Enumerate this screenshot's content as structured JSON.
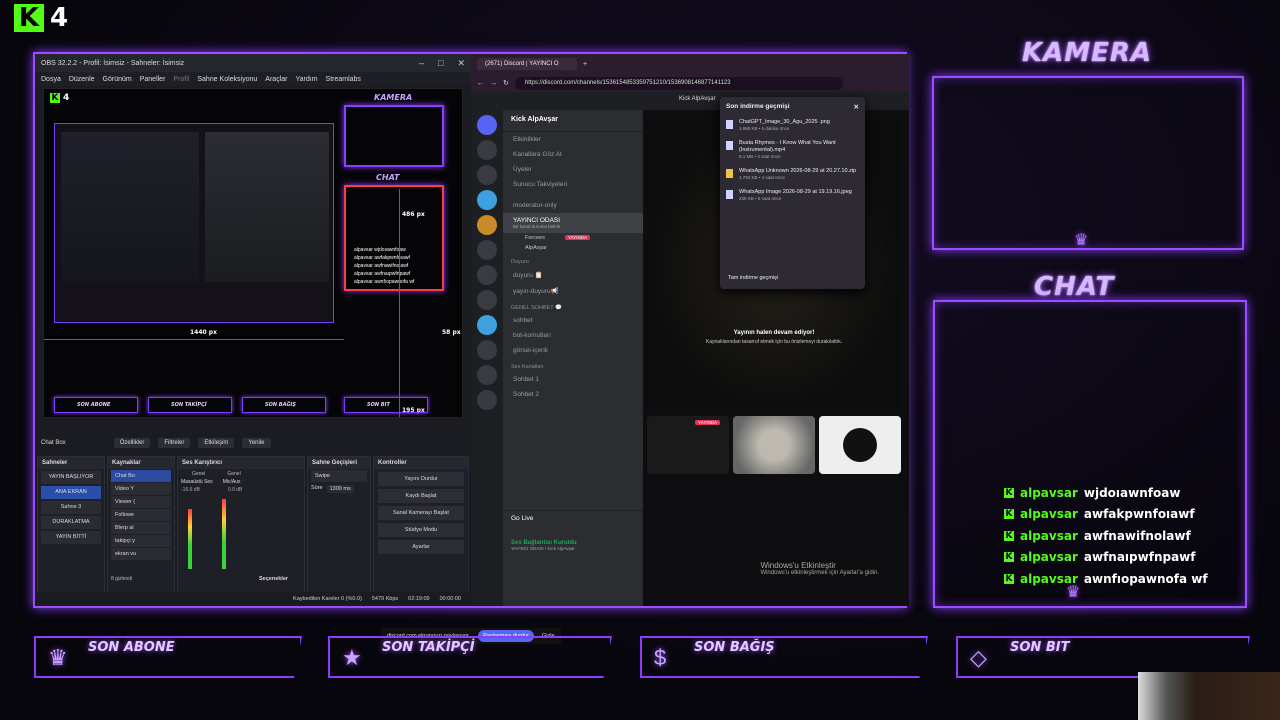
{
  "logo": {
    "number": "4"
  },
  "overlay": {
    "camera_label": "KAMERA",
    "chat_label": "CHAT",
    "bottom": [
      "SON ABONE",
      "SON TAKİPÇİ",
      "SON BAĞIŞ",
      "SON BIT"
    ],
    "chat": [
      {
        "user": "alpavsar",
        "msg": "wjdoıawnfoaw"
      },
      {
        "user": "alpavsar",
        "msg": "awfakpwnfoıawf"
      },
      {
        "user": "alpavsar",
        "msg": "awfnawifnolawf"
      },
      {
        "user": "alpavsar",
        "msg": "awfnaıpwfnpawf"
      },
      {
        "user": "alpavsar",
        "msg": "awnfıopawnofa wf"
      }
    ]
  },
  "obs": {
    "title": "OBS 32.2.2 - Profil: İsimsiz - Sahneler: İsimsiz",
    "menu": [
      "Dosya",
      "Düzenle",
      "Görünüm",
      "Paneller",
      "Profil",
      "Sahne Koleksiyonu",
      "Araçlar",
      "Yardım",
      "Streamlabs"
    ],
    "preview": {
      "px_1440": "1440 px",
      "px_486": "486 px",
      "px_58": "58 px",
      "px_195": "195 px",
      "cam": "KAMERA",
      "chat": "CHAT",
      "mini_chat": [
        "alpavsar wjdoıawnfoaw",
        "alpavsar awfakpwnfoıawf",
        "alpavsar awfnawifnolawf",
        "alpavsar awfnaıpwfnpawf",
        "alpavsar awnfıopawnofa wf"
      ],
      "mini_bottom": [
        "SON ABONE",
        "SON TAKİPÇİ",
        "SON BAĞIŞ",
        "SON BIT"
      ]
    },
    "toolbar": {
      "source": "Chat Box",
      "props": "Özellikler",
      "filters": "Filtreler",
      "interact": "Etkileşim",
      "refresh": "Yenile"
    },
    "docks": {
      "scenes_h": "Sahneler",
      "sources_h": "Kaynaklar",
      "mixer_h": "Ses Karıştırıcı",
      "trans_h": "Sahne Geçişleri",
      "ctrl_h": "Kontroller",
      "scenes": [
        "YAYIN BAŞLIYOR",
        "ANA EKRAN",
        "Sahne 3",
        "DURAKLATMA",
        "YAYIN BİTTİ"
      ],
      "sources": [
        "Chat Bo",
        "Video Y",
        "Viewer (",
        "Followe",
        "Blerp al",
        "takipçi y",
        "ekran vu"
      ],
      "mixer": [
        "Genel",
        "Genel",
        "Masaüstü Ses",
        "Mic/Aux",
        "-16.6 dB",
        "0.0 dB"
      ],
      "transition": "Swipe",
      "duration_label": "Süre",
      "duration": "1300 ms",
      "controls": [
        "Yayını Durdur",
        "Kaydı Başlat",
        "Sanal Kamerayı Başlat",
        "Stüdyo Modu",
        "Ayarlar"
      ],
      "hidden": "8 gizlendi",
      "sceneopts": "Seçenekler"
    },
    "status": {
      "frames": "Kaybedilen Kareler 0 (%0.0)",
      "kbps": "5479 Kbps",
      "time1": "02:19:09",
      "time2": "00:00:00"
    }
  },
  "browser": {
    "tab": "(2671) Discord | YAYINCI O",
    "url": "https://discord.com/channels/1536154853359751210/1536908146877141123",
    "stream_user": "Kick AlpAvşar"
  },
  "discord": {
    "server": "Kick AlpAvşar",
    "channels": [
      "Etkinlikler",
      "Kanallara Göz At",
      "Üyeler",
      "Sunucu Takviyeleri",
      "moderator-only"
    ],
    "voice_active": "YAYINCI ODASI",
    "voice_sub": "Bir kanal durumu belirle",
    "voice_users": [
      "Forcees",
      "AlpAvşar"
    ],
    "live": "YAYINDA",
    "cat1": "Duyuru",
    "cat1_ch": [
      "duyuru 📋",
      "yayın-duyuru📢"
    ],
    "cat2": "GENEL SOHBET 💬",
    "cat2_ch": [
      "sohbet",
      "bot-komutları",
      "görsel-içerik"
    ],
    "cat3": "Ses Kanalları",
    "cat3_ch": [
      "Sohbet 1",
      "Sohbet 2"
    ],
    "golive": "Go Live",
    "conn": "Ses Bağlantısı Kuruldu",
    "conn_sub": "YAYINCI ODASI / Kick AlpAvşar",
    "paused": "Yayının halen devam ediyor!",
    "paused_sub": "Kaynaklarından tasarruf etmek için bu önizlemeyi durakılattık.",
    "tile_live": "YAYINDA",
    "win_act": "Windows'u Etkinleştir",
    "win_act_sub": "Windows'u etkinleştirmek için Ayarlar'a gidin.",
    "share_text": "discord.com ekranınızı paylaşıyor.",
    "share_stop": "Paylaşmayı durdur",
    "share_hide": "Gizle"
  },
  "downloads": {
    "title": "Son indirme geçmişi",
    "items": [
      {
        "name": "ChatGPT_Image_30_Agu_2025 .png",
        "meta": "1.888 KB • 6 dakika önce"
      },
      {
        "name": "Busta Rhymes - I Know What You Want (Instrumental).mp4",
        "meta": "5,1 MB • 3 saat önce"
      },
      {
        "name": "WhatsApp Unknown 2026-08-29 at 20.27.10.zip",
        "meta": "1.793 KB • 4 saat önce"
      },
      {
        "name": "WhatsApp Image 2026-08-29 at 19.19.16.jpeg",
        "meta": "238 KB • 6 saat önce"
      }
    ],
    "footer": "Tam indirme geçmişi"
  },
  "colors": {
    "accent": "#9b4dff",
    "kick": "#53fc18"
  }
}
